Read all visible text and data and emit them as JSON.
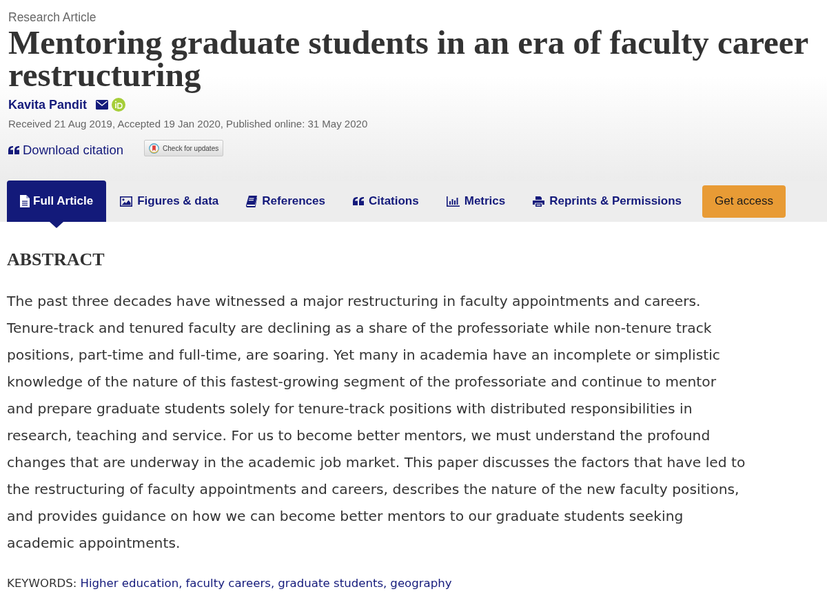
{
  "article_type": "Research Article",
  "title": "Mentoring graduate students in an era of faculty career restructuring",
  "authors": [
    {
      "name": "Kavita Pandit",
      "email": true,
      "orcid": true
    }
  ],
  "dates": "Received 21 Aug 2019, Accepted 19 Jan 2020, Published online: 31 May 2020",
  "download_citation": {
    "label": "Download citation"
  },
  "check_for_updates": {
    "label": "Check for updates"
  },
  "tabs": [
    {
      "label": "Full Article",
      "selected": true
    },
    {
      "label": "Figures & data",
      "selected": false
    },
    {
      "label": "References",
      "selected": false
    },
    {
      "label": "Citations",
      "selected": false
    },
    {
      "label": "Metrics",
      "selected": false
    },
    {
      "label": "Reprints & Permissions",
      "selected": false
    }
  ],
  "access_button": {
    "label": "Get access"
  },
  "abstract": {
    "heading": "ABSTRACT",
    "text": "The past three decades have witnessed a major restructuring in faculty appointments and careers. Tenure-track and tenured faculty are declining as a share of the professoriate while non-tenure track positions, part-time and full-time, are soaring. Yet many in academia have an incomplete or simplistic knowledge of the nature of this fastest-growing segment of the professoriate and continue to mentor and prepare graduate students solely for tenure-track positions with distributed responsibilities in research, teaching and service. For us to become better mentors, we must understand the profound changes that are underway in the academic job market. This paper discusses the factors that have led to the restructuring of faculty appointments and careers, describes the nature of the new faculty positions, and provides guidance on how we can become better mentors to our graduate students seeking academic appointments."
  },
  "keywords": {
    "label": "KEYWORDS:",
    "items": [
      "Higher education,",
      "faculty careers,",
      "graduate students,",
      "geography"
    ]
  }
}
